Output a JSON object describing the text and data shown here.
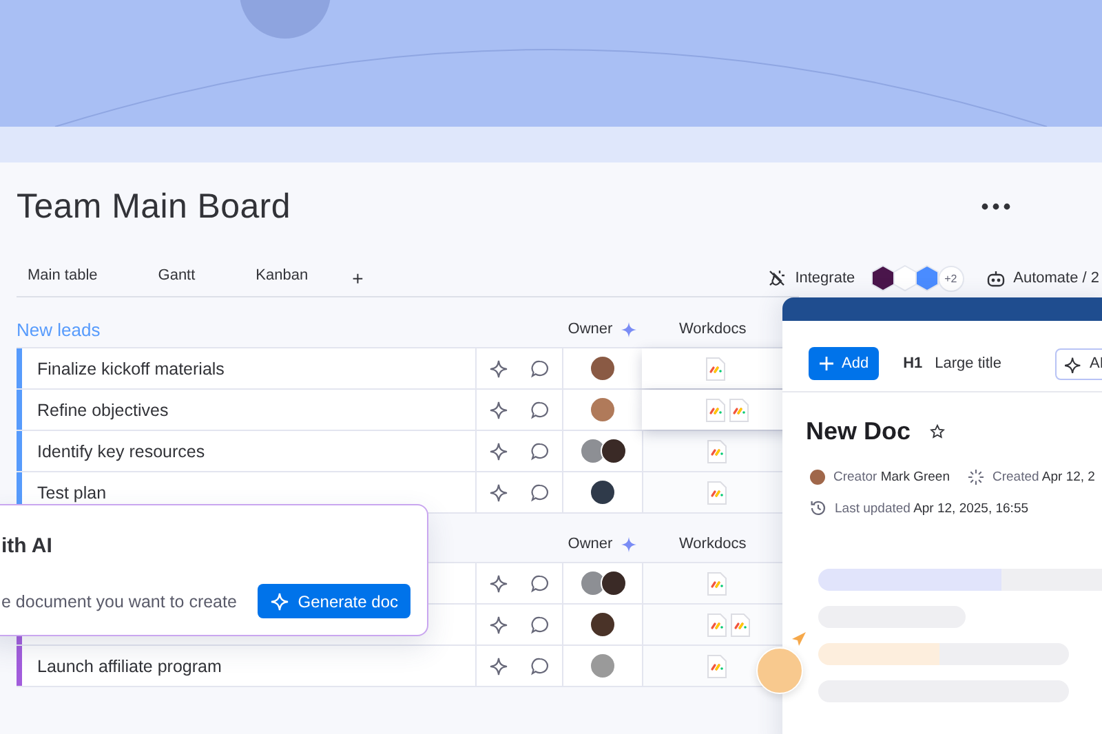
{
  "board": {
    "title": "Team Main Board"
  },
  "tabs": [
    {
      "label": "Main table"
    },
    {
      "label": "Gantt"
    },
    {
      "label": "Kanban"
    }
  ],
  "add_tab": "+",
  "integrate": {
    "label": "Integrate",
    "apps": [
      {
        "color": "#4a154b"
      },
      {
        "color": "#ffffff"
      },
      {
        "color": "#4a8cff"
      }
    ],
    "more": "+2"
  },
  "automate": {
    "label": "Automate / 2"
  },
  "groups": [
    {
      "title": "New leads",
      "color": "#579bfc",
      "columns": [
        "Owner",
        "Workdocs"
      ],
      "rows": [
        {
          "name": "Finalize kickoff materials",
          "owners": [
            {
              "color": "#8a5a44"
            }
          ],
          "docs": [
            {
              "kind": "workdoc"
            }
          ],
          "raised": true
        },
        {
          "name": "Refine objectives",
          "owners": [
            {
              "color": "#b07a5a"
            }
          ],
          "docs": [
            {
              "kind": "workdoc"
            },
            {
              "kind": "workdoc"
            }
          ],
          "raised": true
        },
        {
          "name": "Identify key resources",
          "owners": [
            {
              "color": "#8d8f94"
            },
            {
              "color": "#3a2a26"
            }
          ],
          "docs": [
            {
              "kind": "workdoc"
            }
          ],
          "raised": false
        },
        {
          "name": "Test plan",
          "owners": [
            {
              "color": "#2f3a4a"
            }
          ],
          "docs": [
            {
              "kind": "workdoc"
            }
          ],
          "raised": false
        }
      ]
    },
    {
      "color": "#a25ddc",
      "columns": [
        "Owner",
        "Workdocs"
      ],
      "rows": [
        {
          "owners": [
            {
              "color": "#8d8f94"
            },
            {
              "color": "#3a2a26"
            }
          ],
          "docs": [
            {
              "kind": "workdoc"
            }
          ],
          "raised": false
        },
        {
          "owners": [
            {
              "color": "#4a3328"
            }
          ],
          "docs": [
            {
              "kind": "workdoc"
            },
            {
              "kind": "workdoc"
            }
          ],
          "raised": false
        },
        {
          "name": "Launch affiliate program",
          "owners": [
            {
              "color": "#9a9a9a"
            }
          ],
          "docs": [
            {
              "kind": "workdoc"
            }
          ],
          "raised": false
        }
      ]
    }
  ],
  "ai_popup": {
    "title": "ith AI",
    "prompt": "e document you want to create",
    "button": "Generate doc"
  },
  "doc": {
    "add": "Add",
    "heading_icon": "H1",
    "style": "Large title",
    "ai": "AI",
    "title": "New Doc",
    "creator": "Creator **Mark Green**",
    "created": "Created **Apr 12, 2**",
    "updated": "Last updated **Apr 12, 2025, 16:55**"
  }
}
